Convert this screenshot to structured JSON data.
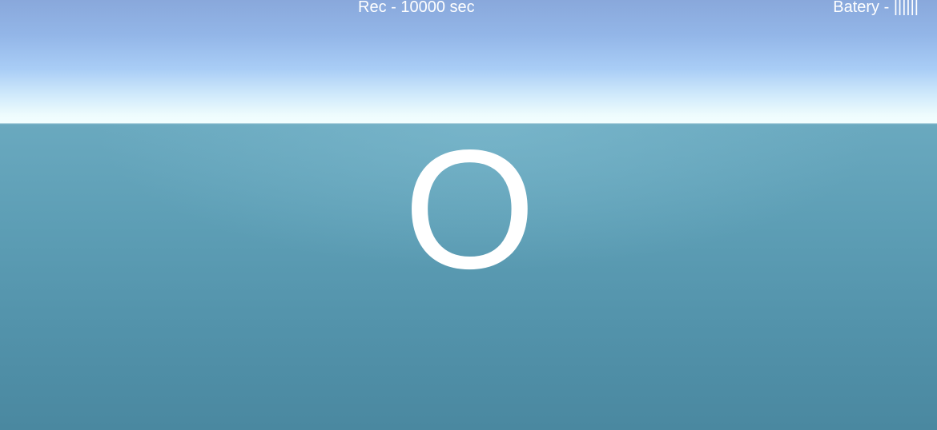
{
  "hud": {
    "rec_label": "Rec - 10000 sec",
    "battery_label": "Batery - ||||||"
  },
  "center": {
    "symbol": "O"
  },
  "colors": {
    "sky_top": "#89a8db",
    "sky_horizon": "#f4ffff",
    "ground_near_horizon": "#6aa9bf",
    "ground_bottom": "#4a88a0",
    "hud_text": "#ffffff"
  }
}
